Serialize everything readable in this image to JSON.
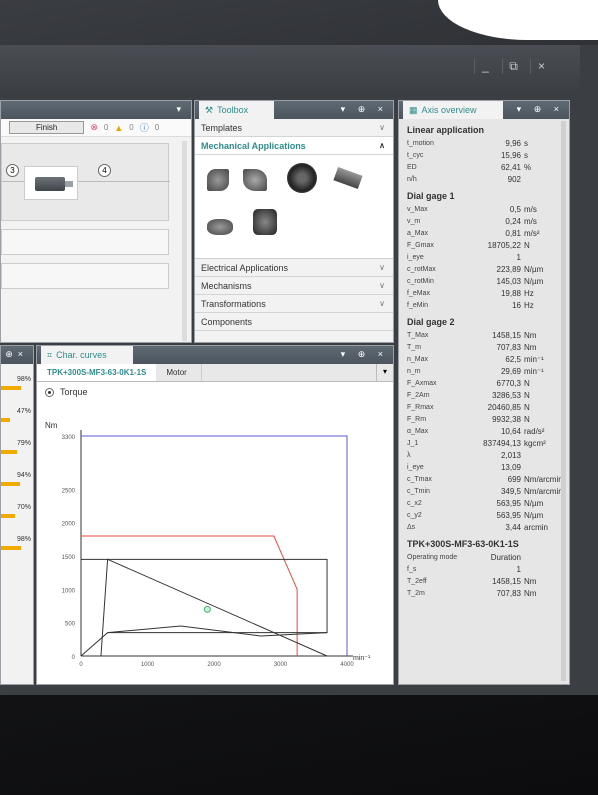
{
  "window": {
    "controls": [
      "_",
      "⧉",
      "×"
    ]
  },
  "editor": {
    "finish_label": "Finish",
    "status": [
      {
        "icon": "error-icon",
        "count": "0"
      },
      {
        "icon": "warning-icon",
        "count": "0"
      },
      {
        "icon": "info-icon",
        "count": "0"
      }
    ],
    "nodes": [
      "3",
      "4"
    ]
  },
  "toolbox": {
    "title": "Toolbox",
    "sections": [
      {
        "label": "Templates",
        "expanded": false
      },
      {
        "label": "Mechanical Applications",
        "expanded": true
      },
      {
        "label": "Electrical Applications",
        "expanded": false
      },
      {
        "label": "Mechanisms",
        "expanded": false
      },
      {
        "label": "Transformations",
        "expanded": false
      },
      {
        "label": "Components",
        "expanded": false
      }
    ]
  },
  "left_panel": {
    "percentages": [
      "98%",
      "47%",
      "79%",
      "94%",
      "70%",
      "98%"
    ]
  },
  "char_curves": {
    "title": "Char. curves",
    "tabs": [
      "TPK+300S-MF3-63-0K1-1S",
      "Motor"
    ],
    "radio_label": "Torque"
  },
  "chart_data": {
    "type": "line",
    "ylabel": "Nm",
    "xunit": "min⁻¹",
    "xlim": [
      0,
      4000
    ],
    "ylim": [
      0,
      3300
    ],
    "xticks": [
      "0",
      "1000",
      "2000",
      "3000",
      "4000"
    ],
    "yticks": [
      "0",
      "500",
      "1000",
      "1500",
      "2000",
      "2500",
      "3300"
    ],
    "series": [
      {
        "color": "#e84a3c",
        "x": [
          0,
          2900,
          3250,
          3250
        ],
        "y": [
          1800,
          1800,
          1000,
          0
        ]
      },
      {
        "color": "#5a5ad0",
        "x": [
          0,
          4000,
          4000
        ],
        "y": [
          3300,
          3300,
          0
        ]
      },
      {
        "color": "#333333",
        "x": [
          0,
          400,
          3700,
          3700,
          400,
          0
        ],
        "y": [
          1450,
          1450,
          1450,
          350,
          350,
          0
        ]
      },
      {
        "color": "#333333",
        "x": [
          300,
          400,
          3700
        ],
        "y": [
          0,
          1450,
          0
        ]
      },
      {
        "color": "#333333",
        "x": [
          400,
          1500,
          2700,
          3700
        ],
        "y": [
          350,
          450,
          300,
          350
        ]
      }
    ],
    "operating_point": {
      "x": 1900,
      "y": 700
    }
  },
  "axis": {
    "title": "Axis overview",
    "sections": [
      {
        "heading": "Linear application",
        "items": [
          [
            "t_motion",
            "9,96",
            "s"
          ],
          [
            "t_cyc",
            "15,96",
            "s"
          ],
          [
            "ED",
            "62,41",
            "%"
          ],
          [
            "n/h",
            "902",
            ""
          ]
        ]
      },
      {
        "heading": "Dial gage 1",
        "items": [
          [
            "v_Max",
            "0,5",
            "m/s"
          ],
          [
            "v_m",
            "0,24",
            "m/s"
          ],
          [
            "a_Max",
            "0,81",
            "m/s²"
          ],
          [
            "F_Gmax",
            "18705,22",
            "N"
          ],
          [
            "i_eye",
            "1",
            ""
          ],
          [
            "c_rotMax",
            "223,89",
            "N/µm"
          ],
          [
            "c_rotMin",
            "145,03",
            "N/µm"
          ],
          [
            "f_eMax",
            "19,88",
            "Hz"
          ],
          [
            "f_eMin",
            "16",
            "Hz"
          ]
        ]
      },
      {
        "heading": "Dial gage 2",
        "items": [
          [
            "T_Max",
            "1458,15",
            "Nm"
          ],
          [
            "T_m",
            "707,83",
            "Nm"
          ],
          [
            "n_Max",
            "62,5",
            "min⁻¹"
          ],
          [
            "n_m",
            "29,69",
            "min⁻¹"
          ],
          [
            "F_Axmax",
            "6770,3",
            "N"
          ],
          [
            "F_2Am",
            "3286,53",
            "N"
          ],
          [
            "F_Rmax",
            "20460,85",
            "N"
          ],
          [
            "F_Rm",
            "9932,38",
            "N"
          ],
          [
            "α_Max",
            "10,64",
            "rad/s²"
          ],
          [
            "J_1",
            "837494,13",
            "kgcm²"
          ],
          [
            "λ",
            "2,013",
            ""
          ],
          [
            "i_eye",
            "13,09",
            ""
          ],
          [
            "c_Tmax",
            "699",
            "Nm/arcmin"
          ],
          [
            "c_Tmin",
            "349,5",
            "Nm/arcmin"
          ],
          [
            "c_x2",
            "563,95",
            "N/µm"
          ],
          [
            "c_y2",
            "563,95",
            "N/µm"
          ],
          [
            "Δs",
            "3,44",
            "arcmin"
          ]
        ]
      },
      {
        "heading": "TPK+300S-MF3-63-0K1-1S",
        "items": [
          [
            "Operating mode",
            "Duration",
            ""
          ],
          [
            "f_s",
            "1",
            ""
          ],
          [
            "T_2eff",
            "1458,15",
            "Nm"
          ],
          [
            "T_2m",
            "707,83",
            "Nm"
          ]
        ]
      }
    ]
  }
}
